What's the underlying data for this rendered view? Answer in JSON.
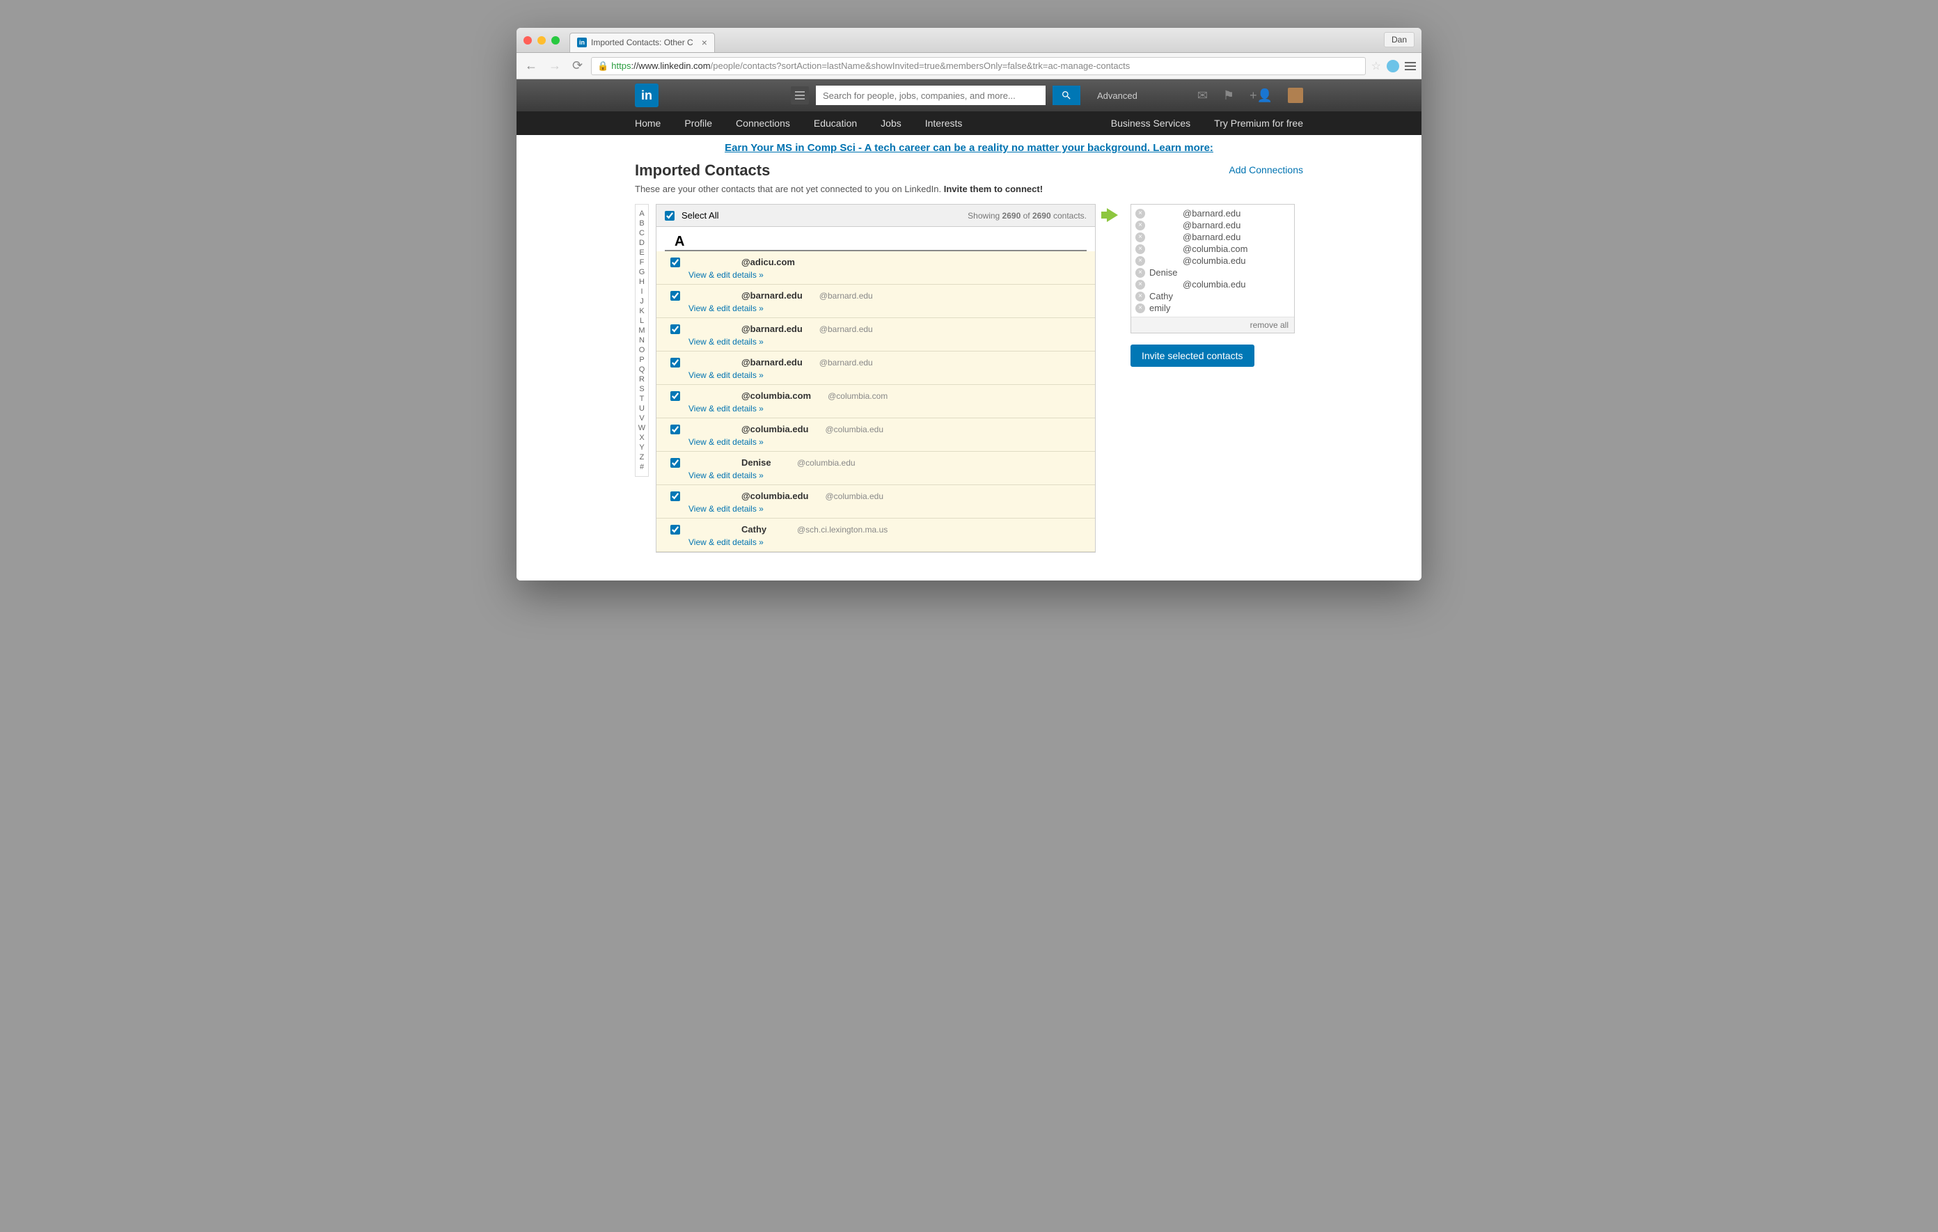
{
  "browser": {
    "tab_title": "Imported Contacts: Other C",
    "user_btn": "Dan",
    "url_https": "https",
    "url_host": "://www.linkedin.com",
    "url_path": "/people/contacts?sortAction=lastName&showInvited=true&membersOnly=false&trk=ac-manage-contacts"
  },
  "header": {
    "search_placeholder": "Search for people, jobs, companies, and more...",
    "advanced": "Advanced",
    "nav": [
      "Home",
      "Profile",
      "Connections",
      "Education",
      "Jobs",
      "Interests"
    ],
    "nav_right": [
      "Business Services",
      "Try Premium for free"
    ]
  },
  "ad": {
    "text": "Earn Your MS in Comp Sci - A tech career can be a reality no matter your background. Learn more:"
  },
  "page": {
    "title": "Imported Contacts",
    "add_connections": "Add Connections",
    "subtitle_a": "These are your other contacts that are not yet connected to you on LinkedIn. ",
    "subtitle_b": "Invite them to connect!",
    "select_all": "Select All",
    "showing_pre": "Showing ",
    "count1": "2690",
    "of": " of ",
    "count2": "2690",
    "contacts_suffix": " contacts.",
    "view_edit": "View & edit details »",
    "letter": "A",
    "az": [
      "A",
      "B",
      "C",
      "D",
      "E",
      "F",
      "G",
      "H",
      "I",
      "J",
      "K",
      "L",
      "M",
      "N",
      "O",
      "P",
      "Q",
      "R",
      "S",
      "T",
      "U",
      "V",
      "W",
      "X",
      "Y",
      "Z",
      "#"
    ]
  },
  "contacts": [
    {
      "name": "",
      "domain": "@adicu.com",
      "email": ""
    },
    {
      "name": "",
      "domain": "@barnard.edu",
      "email": "@barnard.edu"
    },
    {
      "name": "",
      "domain": "@barnard.edu",
      "email": "@barnard.edu"
    },
    {
      "name": "",
      "domain": "@barnard.edu",
      "email": "@barnard.edu"
    },
    {
      "name": "",
      "domain": "@columbia.com",
      "email": "@columbia.com"
    },
    {
      "name": "",
      "domain": "@columbia.edu",
      "email": "@columbia.edu"
    },
    {
      "name": "Denise",
      "domain": "",
      "email": "@columbia.edu"
    },
    {
      "name": "",
      "domain": "@columbia.edu",
      "email": "@columbia.edu"
    },
    {
      "name": "Cathy",
      "domain": "",
      "email": "@sch.ci.lexington.ma.us"
    }
  ],
  "selected": {
    "items": [
      {
        "indent": true,
        "label": "@barnard.edu"
      },
      {
        "indent": true,
        "label": "@barnard.edu"
      },
      {
        "indent": true,
        "label": "@barnard.edu"
      },
      {
        "indent": true,
        "label": "@columbia.com"
      },
      {
        "indent": true,
        "label": "@columbia.edu"
      },
      {
        "indent": false,
        "label": "Denise"
      },
      {
        "indent": true,
        "label": "@columbia.edu"
      },
      {
        "indent": false,
        "label": "Cathy"
      },
      {
        "indent": false,
        "label": "emily"
      }
    ],
    "remove_all": "remove all",
    "invite_btn": "Invite selected contacts"
  }
}
